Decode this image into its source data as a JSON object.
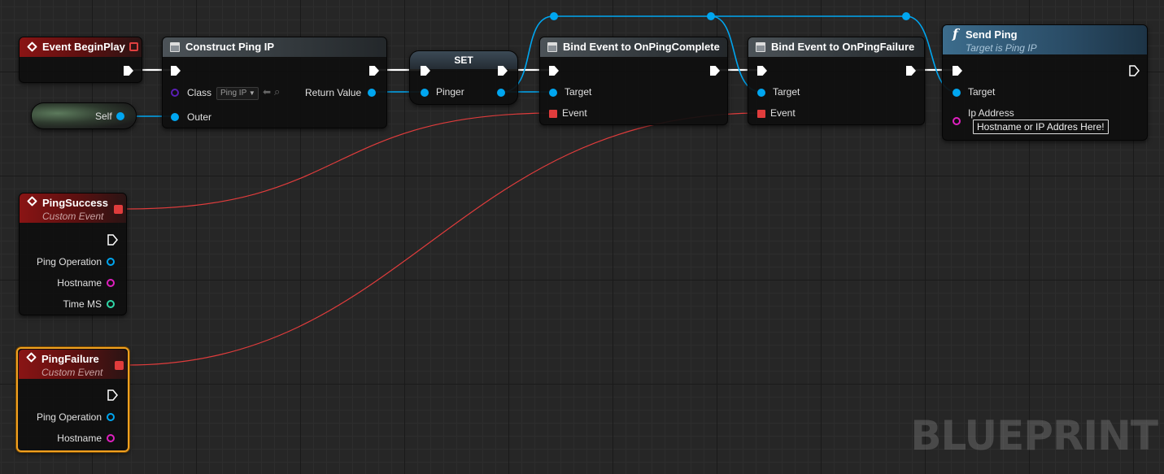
{
  "watermark": "BLUEPRINT",
  "colors": {
    "event_header": "#8a1414",
    "function_header": "#3c6c8c",
    "object_pin": "#00a6f0",
    "class_pin": "#5a1fb4",
    "string_pin": "#e020c0",
    "float_pin": "#30d8a8",
    "delegate_pin": "#e03c3c",
    "selection": "#f0a020"
  },
  "nodes": {
    "begin_play": {
      "title": "Event BeginPlay",
      "icon": "event-diamond-icon"
    },
    "self": {
      "label": "Self"
    },
    "construct": {
      "title": "Construct Ping IP",
      "icon": "construct-object-icon",
      "class_label": "Class",
      "class_value": "Ping IP",
      "outer_label": "Outer",
      "return_label": "Return Value"
    },
    "set": {
      "title": "SET",
      "pinger_label": "Pinger"
    },
    "bind_complete": {
      "title": "Bind Event to OnPingComplete",
      "icon": "bind-event-icon",
      "target_label": "Target",
      "event_label": "Event"
    },
    "bind_failure": {
      "title": "Bind Event to OnPingFailure",
      "icon": "bind-event-icon",
      "target_label": "Target",
      "event_label": "Event"
    },
    "send_ping": {
      "title": "Send Ping",
      "subtitle": "Target is Ping IP",
      "icon": "function-icon",
      "target_label": "Target",
      "ip_label": "Ip Address",
      "ip_value": "Hostname or IP Addres Here!"
    },
    "ping_success": {
      "title": "PingSuccess",
      "subtitle": "Custom Event",
      "icon": "event-diamond-icon",
      "outputs": [
        "Ping Operation",
        "Hostname",
        "Time MS"
      ]
    },
    "ping_failure": {
      "title": "PingFailure",
      "subtitle": "Custom Event",
      "icon": "event-diamond-icon",
      "outputs": [
        "Ping Operation",
        "Hostname"
      ]
    }
  }
}
